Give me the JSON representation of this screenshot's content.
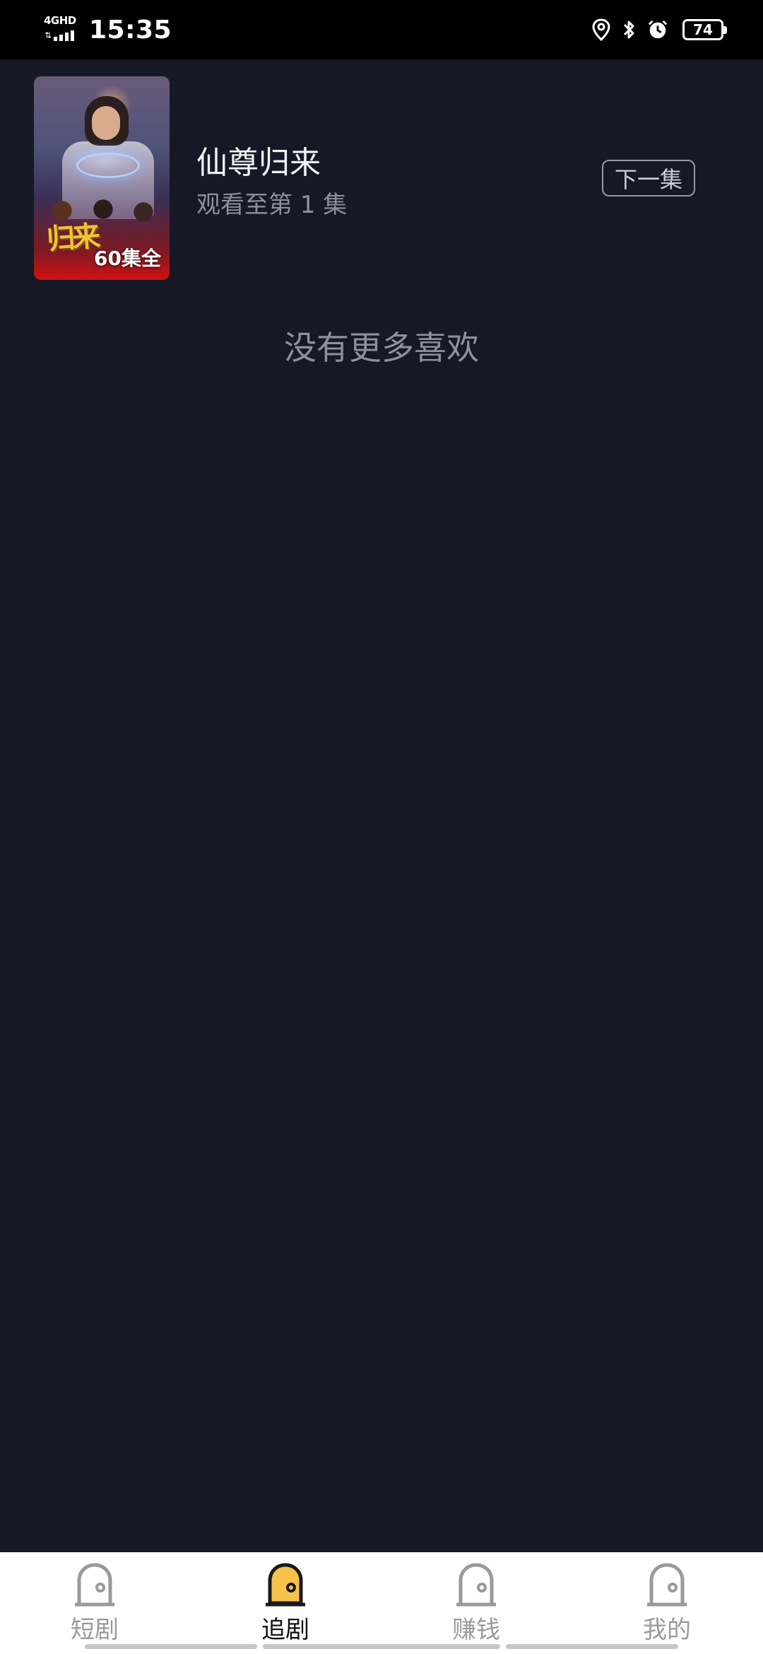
{
  "status_bar": {
    "network": "4GHD",
    "time": "15:35",
    "battery": "74",
    "icons": [
      "location-icon",
      "bluetooth-icon",
      "alarm-icon"
    ]
  },
  "show": {
    "title": "仙尊归来",
    "progress": "观看至第 1 集",
    "episodes_badge": "60集全",
    "next_button": "下一集",
    "poster_logo": "归来"
  },
  "empty_message": "没有更多喜欢",
  "bottom_nav": {
    "items": [
      {
        "label": "短剧",
        "active": false
      },
      {
        "label": "追剧",
        "active": true
      },
      {
        "label": "赚钱",
        "active": false
      },
      {
        "label": "我的",
        "active": false
      }
    ]
  },
  "colors": {
    "background": "#171826",
    "nav_active_fill": "#f7c24a",
    "nav_inactive_stroke": "#9a9a9a"
  }
}
